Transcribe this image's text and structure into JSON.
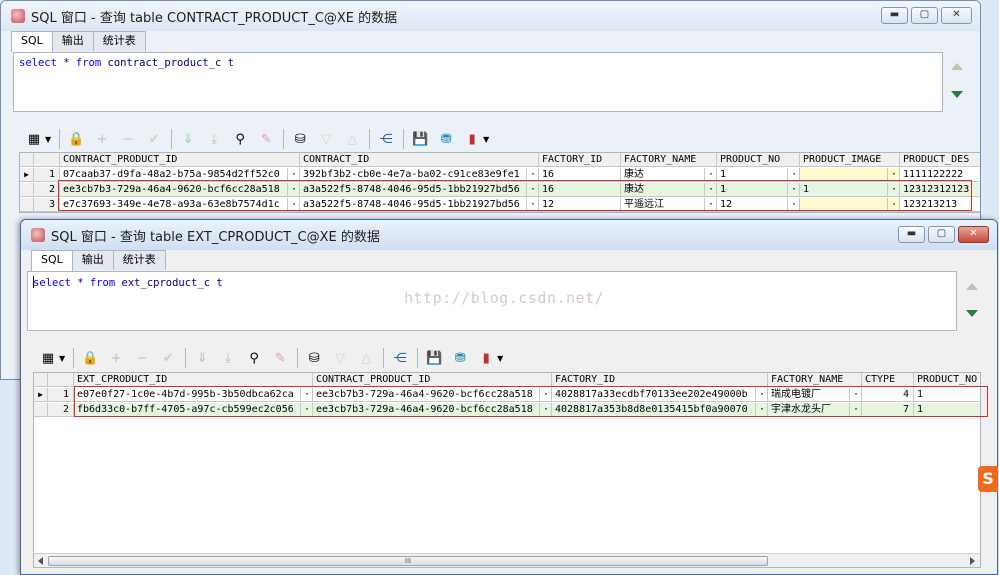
{
  "window1": {
    "title": "SQL 窗口 - 查询 table CONTRACT_PRODUCT_C@XE 的数据",
    "tabs": [
      "SQL",
      "输出",
      "统计表"
    ],
    "sql_keyword_select": "select",
    "sql_star": " * ",
    "sql_keyword_from": "from",
    "sql_rest": " contract_product_c t",
    "grid": {
      "columns": [
        "CONTRACT_PRODUCT_ID",
        "CONTRACT_ID",
        "FACTORY_ID",
        "FACTORY_NAME",
        "PRODUCT_NO",
        "PRODUCT_IMAGE",
        "PRODUCT_DES"
      ],
      "rows": [
        {
          "num": "1",
          "cells": [
            "07caab37-d9fa-48a2-b75a-9854d2ff52c0",
            "392bf3b2-cb0e-4e7a-ba02-c91ce83e9fe1",
            "16",
            "康达",
            "1",
            "",
            "1111122222"
          ]
        },
        {
          "num": "2",
          "cells": [
            "ee3cb7b3-729a-46a4-9620-bcf6cc28a518",
            "a3a522f5-8748-4046-95d5-1bb21927bd56",
            "16",
            "康达",
            "1",
            "1",
            "12312312123"
          ]
        },
        {
          "num": "3",
          "cells": [
            "e7c37693-349e-4e78-a93a-63e8b7574d1c",
            "a3a522f5-8748-4046-95d5-1bb21927bd56",
            "12",
            "平遥远江",
            "12",
            "",
            "123213213"
          ]
        }
      ]
    }
  },
  "window2": {
    "title": "SQL 窗口 - 查询 table EXT_CPRODUCT_C@XE 的数据",
    "tabs": [
      "SQL",
      "输出",
      "统计表"
    ],
    "sql_keyword_select": "select",
    "sql_star": " * ",
    "sql_keyword_from": "from",
    "sql_rest": " ext_cproduct_c t",
    "grid": {
      "columns": [
        "EXT_CPRODUCT_ID",
        "CONTRACT_PRODUCT_ID",
        "FACTORY_ID",
        "FACTORY_NAME",
        "CTYPE",
        "PRODUCT_NO"
      ],
      "rows": [
        {
          "num": "1",
          "cells": [
            "e07e0f27-1c0e-4b7d-995b-3b50dbca62ca",
            "ee3cb7b3-729a-46a4-9620-bcf6cc28a518",
            "4028817a33ecdbf70133ee202e49000b",
            "瑞成电镀厂",
            "4",
            "1"
          ]
        },
        {
          "num": "2",
          "cells": [
            "fb6d33c0-b7ff-4705-a97c-cb599ec2c056",
            "ee3cb7b3-729a-46a4-9620-bcf6cc28a518",
            "4028817a353b8d8e0135415bf0a90070",
            "宇津水龙头厂",
            "7",
            "1"
          ]
        }
      ]
    },
    "hscroll_grip": "III"
  },
  "watermark": "http://blog.csdn.net/",
  "side_icon": "S",
  "colors": {
    "highlight_row": "#e6f5e0",
    "red_box": "#d03030",
    "sql_keyword": "#0000ff"
  }
}
